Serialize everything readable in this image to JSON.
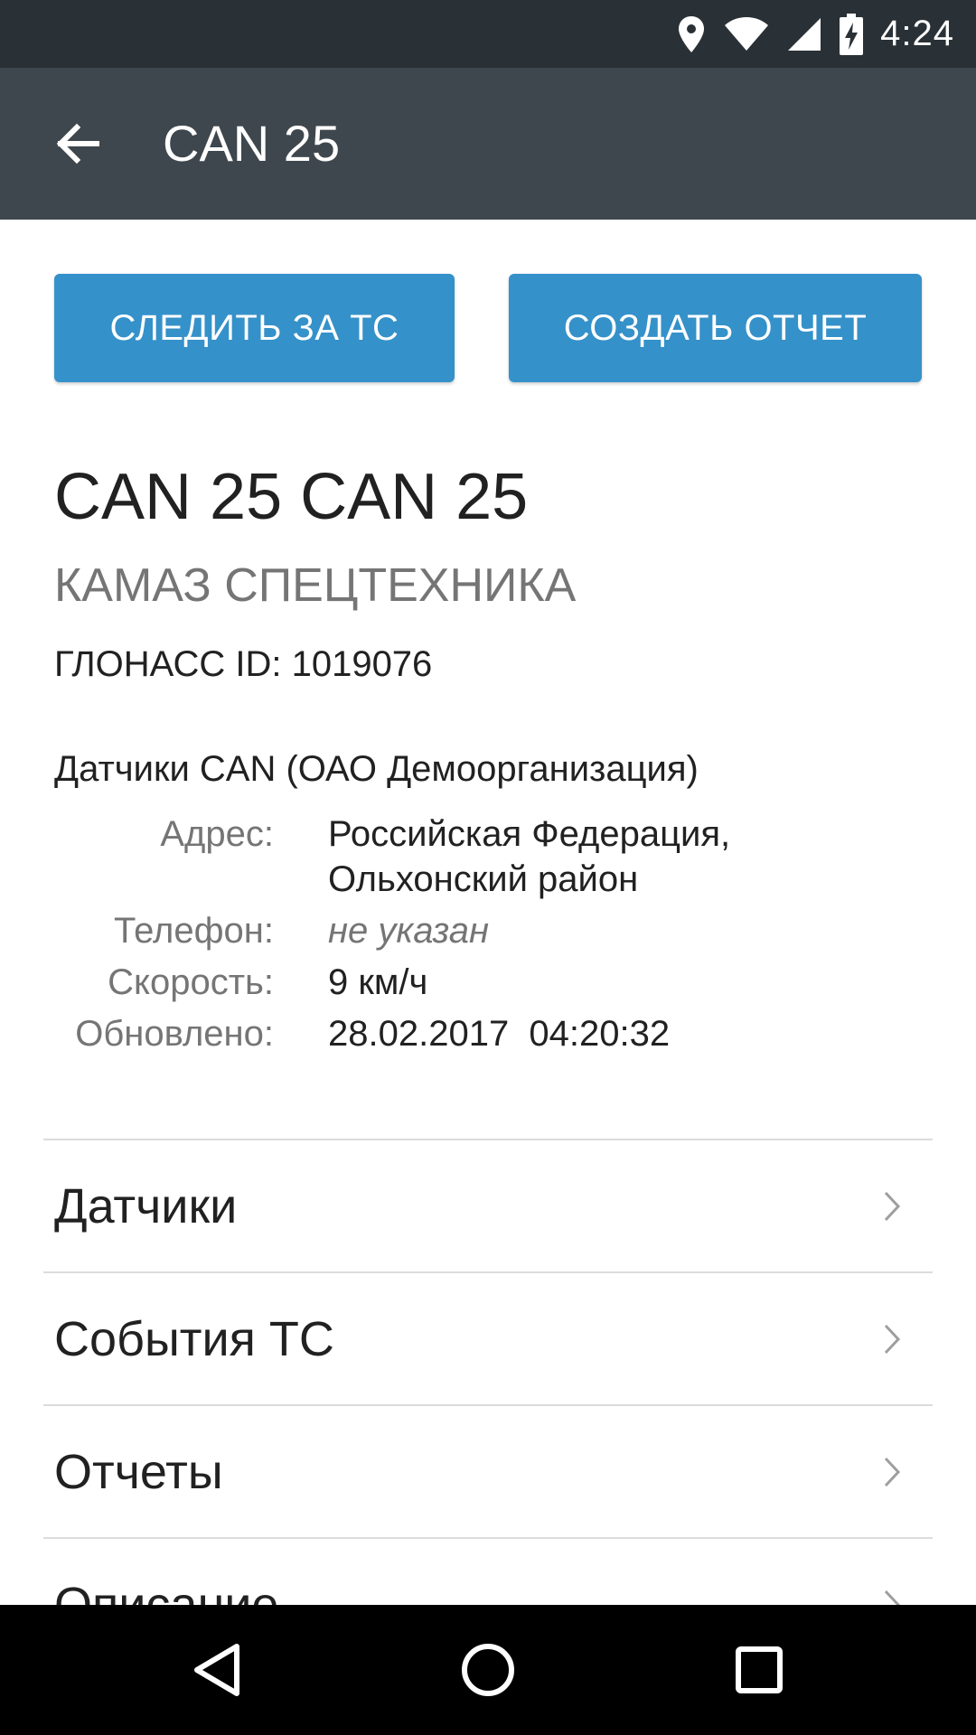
{
  "status_bar": {
    "time": "4:24",
    "icons": [
      "location-icon",
      "wifi-icon",
      "signal-icon",
      "battery-charging-icon"
    ]
  },
  "app_bar": {
    "back_icon": "arrow-back-icon",
    "title": "CAN 25"
  },
  "actions": {
    "follow_label": "СЛЕДИТЬ ЗА ТС",
    "report_label": "СОЗДАТЬ ОТЧЕТ",
    "button_color": "#3591c9"
  },
  "vehicle": {
    "name": "CAN 25 CAN 25",
    "type": "КАМАЗ СПЕЦТЕХНИКА",
    "glonass": "ГЛОНАСС ID: 1019076",
    "organization": "Датчики CAN (ОАО Демоорганизация)"
  },
  "info": {
    "address_label": "Адрес:",
    "address_line1": "Российская Федерация,",
    "address_line2": "Ольхонский район",
    "phone_label": "Телефон:",
    "phone_value": "не указан",
    "speed_label": "Скорость:",
    "speed_value": "9 км/ч",
    "updated_label": "Обновлено:",
    "updated_value": "28.02.2017  04:20:32"
  },
  "menu": {
    "items": [
      {
        "label": "Датчики"
      },
      {
        "label": "События ТС"
      },
      {
        "label": "Отчеты"
      },
      {
        "label": "Описание"
      }
    ]
  },
  "nav_bar": {
    "icons": [
      "back-triangle-icon",
      "home-circle-icon",
      "recents-square-icon"
    ]
  }
}
